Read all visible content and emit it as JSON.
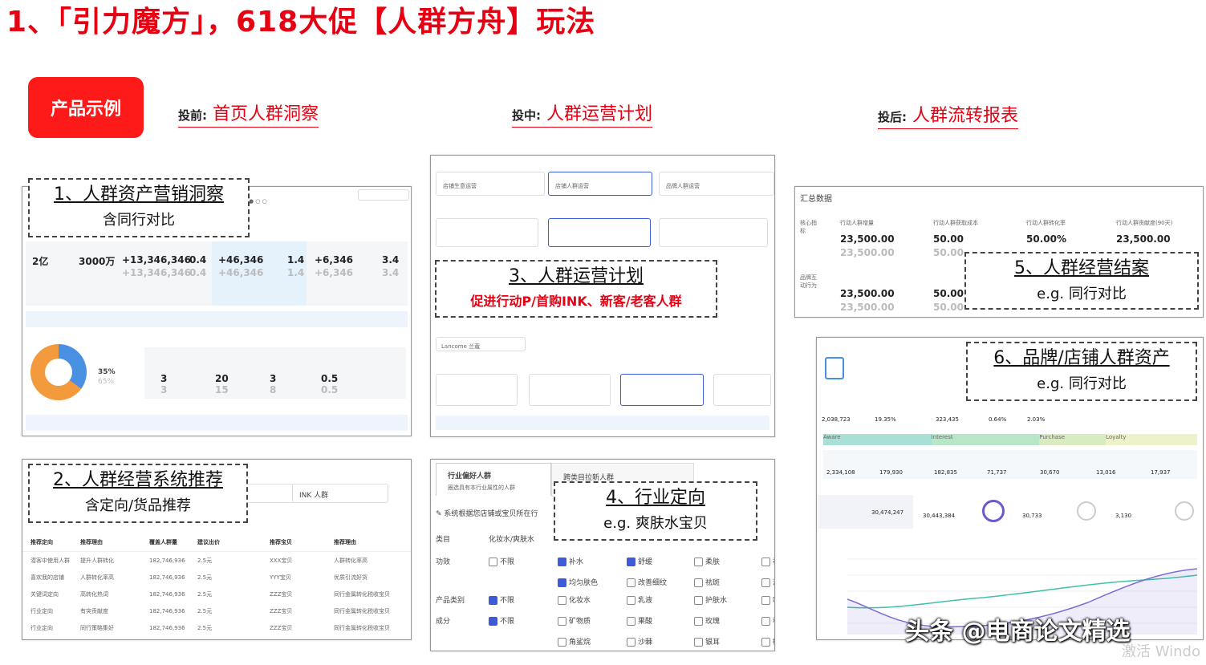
{
  "title": "1、「引力魔方」，618大促【人群方舟】玩法",
  "badge": "产品示例",
  "phases": [
    {
      "pre": "投前:",
      "label": "首页人群洞察"
    },
    {
      "pre": "投中:",
      "label": "人群运营计划"
    },
    {
      "pre": "投后:",
      "label": "人群流转报表"
    }
  ],
  "callouts": {
    "c1": {
      "h": "1、人群资产营销洞察",
      "s": "含同行对比"
    },
    "c2": {
      "h": "2、人群经营系统推荐",
      "s": "含定向/货品推荐"
    },
    "c3": {
      "h": "3、人群运营计划",
      "r": "促进行动P/首购INK、新客/老客人群"
    },
    "c4": {
      "h": "4、行业定向",
      "s": "e.g. 爽肤水宝贝"
    },
    "c5": {
      "h": "5、人群经营结案",
      "s": "e.g. 同行对比"
    },
    "c6": {
      "h": "6、品牌/店铺人群资产",
      "s": "e.g. 同行对比"
    }
  },
  "p1": {
    "stats": [
      {
        "v": "2亿",
        "c": ""
      },
      {
        "v": "3000万",
        "c": ""
      },
      {
        "v": "+13,346,346",
        "c": "+13,346,346"
      },
      {
        "v": "0.4",
        "c": "0.4"
      },
      {
        "v": "+46,346",
        "c": "+46,346"
      },
      {
        "v": "1.4",
        "c": "1.4"
      },
      {
        "v": "+6,346",
        "c": "+6,346"
      },
      {
        "v": "3.4",
        "c": "3.4"
      }
    ],
    "donut_pct": "35%",
    "donut_cmp": "65%",
    "mini": [
      {
        "v": "3",
        "c": "3"
      },
      {
        "v": "20",
        "c": "15"
      },
      {
        "v": "3",
        "c": "8"
      },
      {
        "v": "0.5",
        "c": "0.5"
      }
    ]
  },
  "p2": {
    "tab2": "INK 人群",
    "headers": [
      "推荐定向",
      "推荐理由",
      "覆盖人群量",
      "建议出价",
      "推荐宝贝",
      "推荐理由"
    ],
    "rows": [
      [
        "潜客中使用人群",
        "提升人群转化",
        "182,746,936",
        "2.5元",
        "XXX宝贝",
        "人群转化率高"
      ],
      [
        "喜欢我的店铺",
        "人群转化率高",
        "182,746,936",
        "2.5元",
        "YYY宝贝",
        "优质引流好货"
      ],
      [
        "关键词定向",
        "高转化热词",
        "182,746,936",
        "2.5元",
        "ZZZ宝贝",
        "同行金属转化税收宝贝"
      ],
      [
        "行业定向",
        "有突贡献度",
        "182,746,936",
        "2.5元",
        "ZZZ宝贝",
        "同行金属转化税收宝贝"
      ],
      [
        "行业定向",
        "同行策略集好",
        "182,746,936",
        "2.5元",
        "ZZZ宝贝",
        "同行金属转化税收宝贝"
      ]
    ]
  },
  "p3": {
    "opts": [
      "店铺生意运营",
      "店铺人群运营",
      "品牌人群运营"
    ],
    "brand": "Lancome 兰蔻"
  },
  "p4": {
    "tab1": "行业偏好人群",
    "tab1_sub": "圈选具有本行业属性的人群",
    "tab2": "跨类目拉新人群",
    "hint": "系统根据您店铺或宝贝所在行",
    "cat_label": "类目",
    "cat_value": "化妆水/爽肤水",
    "rows": [
      {
        "label": "功效",
        "items": [
          [
            "不限",
            false
          ],
          [
            "补水",
            true
          ],
          [
            "舒缓",
            true
          ],
          [
            "柔肤",
            false
          ],
          [
            "祛痘",
            false
          ]
        ]
      },
      {
        "label": "",
        "items": [
          [
            "",
            null
          ],
          [
            "均匀肤色",
            true
          ],
          [
            "改善细纹",
            false
          ],
          [
            "祛斑",
            false
          ],
          [
            "淡化红",
            false
          ]
        ]
      },
      {
        "label": "产品类别",
        "items": [
          [
            "不限",
            true
          ],
          [
            "化妆水",
            false
          ],
          [
            "乳液",
            false
          ],
          [
            "护肤水",
            false
          ],
          [
            "啫喱",
            false
          ]
        ]
      },
      {
        "label": "成分",
        "items": [
          [
            "不限",
            true
          ],
          [
            "矿物质",
            false
          ],
          [
            "果酸",
            false
          ],
          [
            "玫瑰",
            false
          ],
          [
            "积雪草",
            false
          ]
        ]
      },
      {
        "label": "",
        "items": [
          [
            "",
            null
          ],
          [
            "角鲨烷",
            false
          ],
          [
            "沙棘",
            false
          ],
          [
            "银耳",
            false
          ],
          [
            "樱花",
            false
          ]
        ]
      }
    ]
  },
  "p5": {
    "header": "汇总数据",
    "left_labels": [
      "核心指标",
      "品牌互动行为"
    ],
    "cols": [
      "行动人群增量",
      "行动人群获取成本",
      "行动人群转化率",
      "行动人群贡献度(90天)"
    ],
    "vals": [
      [
        "23,500.00",
        "50.00",
        "50.00%",
        "23,500.00"
      ],
      [
        "23,500.00",
        "50.00",
        "",
        ""
      ],
      [
        "23,500.00",
        "50.00",
        "",
        ""
      ],
      [
        "23,500.00",
        "50.00",
        "",
        ""
      ]
    ]
  },
  "p6": {
    "nums": [
      "2,038,723",
      "19.35%",
      "323,435",
      "0.64%",
      "2.03%"
    ],
    "funnel": [
      "Aware",
      "Interest",
      "Purchase",
      "Loyalty"
    ],
    "funnel_nums": [
      "2,334,108",
      "179,930",
      "182,835",
      "71,737",
      "30,670",
      "13,016",
      "17,937"
    ],
    "cards": [
      "30,474,247",
      "30,443,384",
      "30,733",
      "3,130"
    ]
  },
  "watermark": "头条 @电商论文精选",
  "os_watermark": "激活 Windo"
}
